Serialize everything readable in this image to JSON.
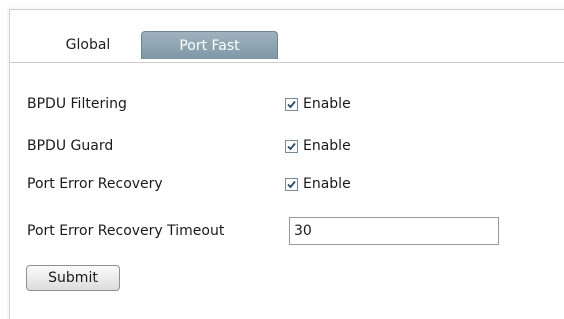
{
  "tabs": [
    {
      "label": "Global",
      "active": false
    },
    {
      "label": "Port Fast",
      "active": true
    }
  ],
  "form": {
    "bpdu_filtering": {
      "label": "BPDU Filtering",
      "option": "Enable",
      "checked": true
    },
    "bpdu_guard": {
      "label": "BPDU Guard",
      "option": "Enable",
      "checked": true
    },
    "port_error_recovery": {
      "label": "Port Error Recovery",
      "option": "Enable",
      "checked": true
    },
    "timeout": {
      "label": "Port Error Recovery Timeout",
      "value": "30"
    },
    "submit_label": "Submit"
  },
  "colors": {
    "active_tab": "#8aa1ae",
    "checkbox_border": "#7a8a99",
    "check_mark": "#2d4a66"
  }
}
